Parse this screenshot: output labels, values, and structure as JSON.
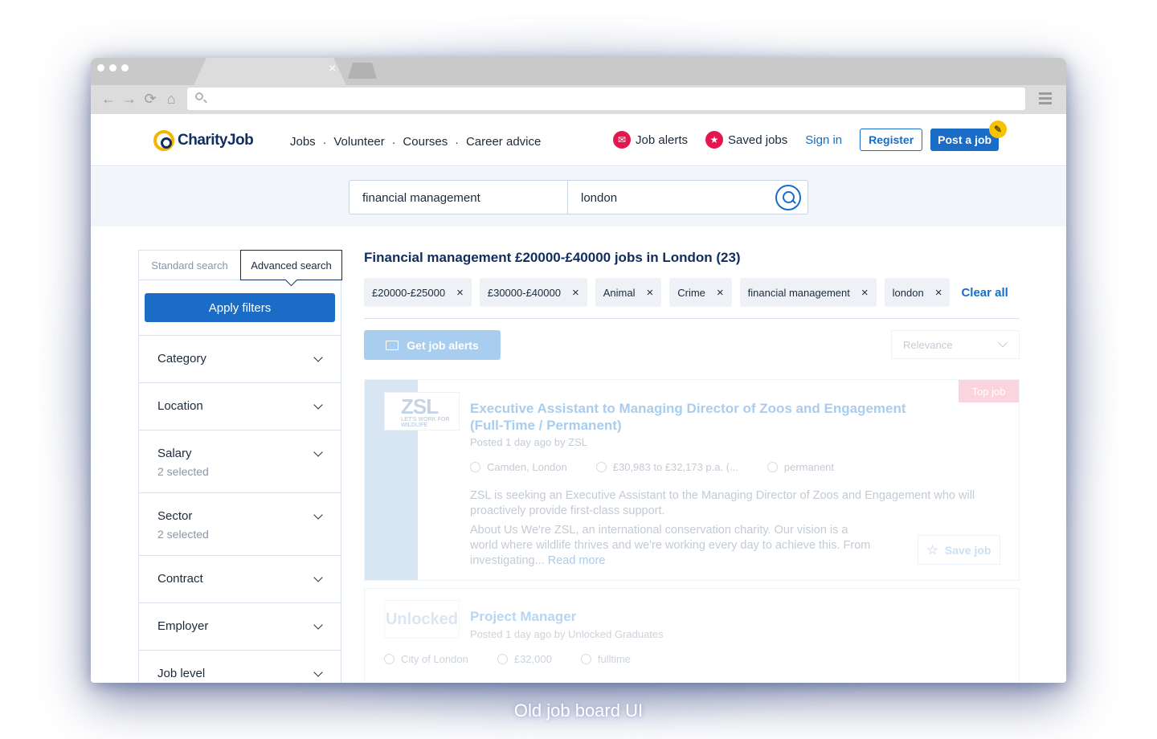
{
  "browser": {
    "tab_close": "×",
    "nav": {
      "back": "←",
      "forward": "→",
      "reload": "⟳",
      "home": "⌂"
    }
  },
  "header": {
    "logo": "CharityJob",
    "nav": [
      "Jobs",
      "Volunteer",
      "Courses",
      "Career advice"
    ],
    "nav_separator": "·",
    "job_alerts": "Job alerts",
    "saved_jobs": "Saved jobs",
    "sign_in": "Sign in",
    "register": "Register",
    "post_job": "Post a job"
  },
  "search": {
    "keywords": "financial management",
    "location": "london"
  },
  "sidebar": {
    "tab_standard": "Standard search",
    "tab_advanced": "Advanced search",
    "apply": "Apply filters",
    "filters": [
      {
        "title": "Category",
        "sub": ""
      },
      {
        "title": "Location",
        "sub": ""
      },
      {
        "title": "Salary",
        "sub": "2 selected"
      },
      {
        "title": "Sector",
        "sub": "2 selected"
      },
      {
        "title": "Contract",
        "sub": ""
      },
      {
        "title": "Employer",
        "sub": ""
      },
      {
        "title": "Job level",
        "sub": ""
      }
    ]
  },
  "results": {
    "title": "Financial management £20000-£40000 jobs in London (23)",
    "chips": [
      "£20000-£25000",
      "£30000-£40000",
      "Animal",
      "Crime",
      "financial management",
      "london"
    ],
    "chip_remove": "×",
    "clear_all": "Clear all",
    "get_alerts": "Get job alerts",
    "sort": "Relevance",
    "jobs": [
      {
        "logo_text": "ZSL",
        "logo_sub": "LET'S WORK FOR WILDLIFE",
        "badge": "Top job",
        "title": "Executive Assistant to Managing Director of Zoos and Engagement (Full-Time / Permanent)",
        "posted": "Posted 1 day ago by ZSL",
        "location": "Camden, London",
        "salary": "£30,983 to £32,173 p.a. (...",
        "contract": "permanent",
        "description": "ZSL is seeking an Executive Assistant to the Managing Director of Zoos and Engagement who will proactively provide first-class support.",
        "about": "About Us We're ZSL, an international conservation charity. Our vision is a world where wildlife thrives and we're working every day to achieve this. From investigating...",
        "read_more": "Read more",
        "save": "Save job"
      },
      {
        "logo_text": "Unlocked",
        "title": "Project Manager",
        "posted": "Posted 1 day ago by Unlocked Graduates",
        "location": "City of London",
        "salary": "£32,000",
        "contract": "fulltime"
      }
    ]
  },
  "caption": "Old job board UI"
}
